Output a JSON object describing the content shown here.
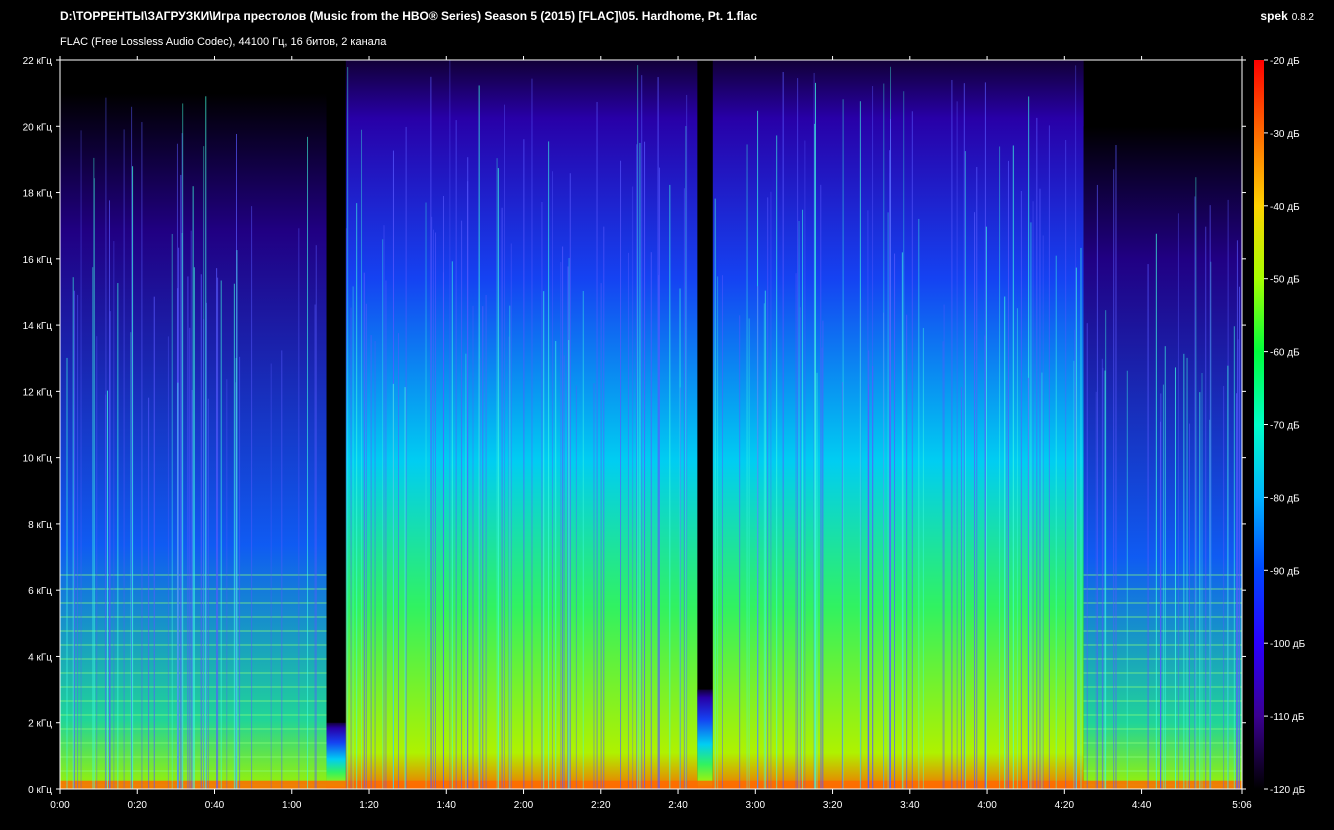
{
  "header": {
    "title": "D:\\ТОРРЕНТЫ\\ЗАГРУЗКИ\\Игра престолов (Music from the HBO® Series) Season 5 (2015) [FLAC]\\05. Hardhome, Pt. 1.flac",
    "subtitle": "FLAC (Free Lossless Audio Codec), 44100 Гц, 16 битов, 2 канала",
    "app_name": "spek",
    "app_version": "0.8.2"
  },
  "chart_data": {
    "type": "heatmap",
    "title": "",
    "xlabel": "",
    "ylabel": "",
    "x_unit": "time (m:ss)",
    "y_unit": "kHz",
    "xlim_seconds": [
      0,
      306
    ],
    "ylim_khz": [
      0,
      22
    ],
    "x_ticks": [
      "0:00",
      "0:20",
      "0:40",
      "1:00",
      "1:20",
      "1:40",
      "2:00",
      "2:20",
      "2:40",
      "3:00",
      "3:20",
      "3:40",
      "4:00",
      "4:20",
      "4:40",
      "5:06"
    ],
    "x_tick_seconds": [
      0,
      20,
      40,
      60,
      80,
      100,
      120,
      140,
      160,
      180,
      200,
      220,
      240,
      260,
      280,
      306
    ],
    "y_ticks": [
      "0 кГц",
      "2 кГц",
      "4 кГц",
      "6 кГц",
      "8 кГц",
      "10 кГц",
      "12 кГц",
      "14 кГц",
      "16 кГц",
      "18 кГц",
      "20 кГц",
      "22 кГц"
    ],
    "y_tick_khz": [
      0,
      2,
      4,
      6,
      8,
      10,
      12,
      14,
      16,
      18,
      20,
      22
    ],
    "colorbar": {
      "labels": [
        "-20 дБ",
        "-30 дБ",
        "-40 дБ",
        "-50 дБ",
        "-60 дБ",
        "-70 дБ",
        "-80 дБ",
        "-90 дБ",
        "-100 дБ",
        "-110 дБ",
        "-120 дБ"
      ],
      "values_db": [
        -20,
        -30,
        -40,
        -50,
        -60,
        -70,
        -80,
        -90,
        -100,
        -110,
        -120
      ],
      "range_db": [
        -120,
        -20
      ],
      "colors_high_to_low": [
        "#ff0000",
        "#ff6a00",
        "#ffd200",
        "#a6ff00",
        "#00ff3c",
        "#00ffc8",
        "#00b4ff",
        "#0046ff",
        "#2a00ff",
        "#3a0090",
        "#000000"
      ]
    },
    "segments": [
      {
        "start_s": 0,
        "end_s": 69,
        "peak_khz": 21
      },
      {
        "start_s": 69,
        "end_s": 74,
        "peak_khz": 2
      },
      {
        "start_s": 74,
        "end_s": 165,
        "peak_khz": 22
      },
      {
        "start_s": 165,
        "end_s": 169,
        "peak_khz": 3
      },
      {
        "start_s": 169,
        "end_s": 265,
        "peak_khz": 22
      },
      {
        "start_s": 265,
        "end_s": 306,
        "peak_khz": 20
      }
    ]
  }
}
